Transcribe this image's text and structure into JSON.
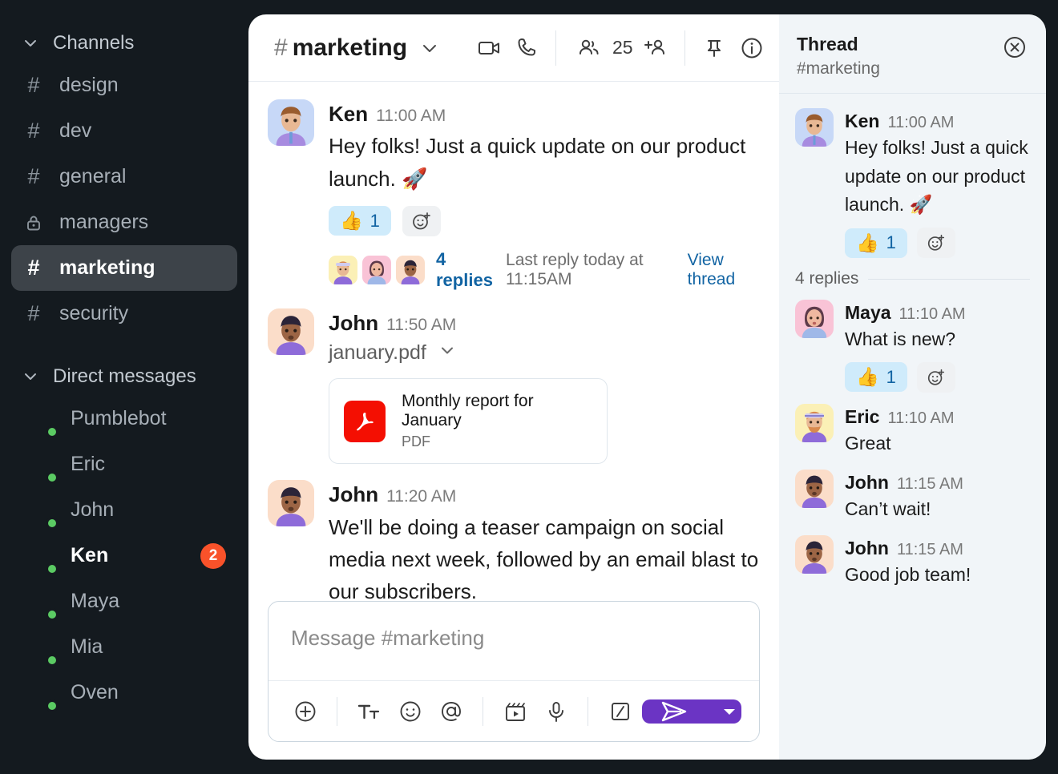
{
  "sidebar": {
    "channels_section": {
      "label": "Channels",
      "icon": "chevron-down-icon"
    },
    "channels": [
      {
        "label": "design",
        "icon": "hash-icon",
        "active": false
      },
      {
        "label": "dev",
        "icon": "hash-icon",
        "active": false
      },
      {
        "label": "general",
        "icon": "hash-icon",
        "active": false
      },
      {
        "label": "managers",
        "icon": "lock-icon",
        "active": false
      },
      {
        "label": "marketing",
        "icon": "hash-icon",
        "active": true
      },
      {
        "label": "security",
        "icon": "hash-icon",
        "active": false
      }
    ],
    "dm_section": {
      "label": "Direct messages",
      "icon": "chevron-down-icon"
    },
    "dms": [
      {
        "label": "Pumblebot",
        "status": "online",
        "badge": "",
        "unread": false,
        "avatar": "bot"
      },
      {
        "label": "Eric",
        "status": "online",
        "badge": "",
        "unread": false,
        "avatar": "eric"
      },
      {
        "label": "John",
        "status": "online",
        "badge": "",
        "unread": false,
        "avatar": "john"
      },
      {
        "label": "Ken",
        "status": "online",
        "badge": "2",
        "unread": true,
        "avatar": "ken"
      },
      {
        "label": "Maya",
        "status": "online",
        "badge": "",
        "unread": false,
        "avatar": "maya"
      },
      {
        "label": "Mia",
        "status": "online",
        "badge": "",
        "unread": false,
        "avatar": "mia"
      },
      {
        "label": "Oven",
        "status": "online",
        "badge": "",
        "unread": false,
        "avatar": "oven"
      }
    ]
  },
  "chat_header": {
    "hash": "#",
    "channel": "marketing",
    "chevron": "chevron-down-icon",
    "video_icon": "video-camera-icon",
    "call_icon": "phone-icon",
    "members_icon": "people-icon",
    "members_count": "25",
    "add_member_icon": "add-person-icon",
    "pin_icon": "pin-icon",
    "info_icon": "info-icon"
  },
  "messages": [
    {
      "author": "Ken",
      "time": "11:00 AM",
      "text": "Hey folks! Just a quick update on our product launch. 🚀",
      "avatar": "ken",
      "reaction": {
        "emoji": "👍",
        "count": "1"
      },
      "add_reaction_icon": "add-reaction-icon",
      "thread": {
        "replies_label": "4 replies",
        "last_reply": "Last reply today at 11:15AM",
        "view_thread": "View thread",
        "participants": [
          "eric",
          "maya",
          "john"
        ]
      }
    },
    {
      "author": "John",
      "time": "11:50 AM",
      "filename": "january.pdf",
      "file_chevron": "chevron-down-icon",
      "avatar": "john",
      "attachment": {
        "title": "Monthly report for January",
        "type": "PDF",
        "icon": "pdf-icon"
      }
    },
    {
      "author": "John",
      "time": "11:20 AM",
      "text": "We'll be doing a teaser campaign on social media next week, followed by an email blast to our subscribers.",
      "avatar": "john"
    }
  ],
  "composer": {
    "placeholder": "Message #marketing",
    "tools": [
      {
        "name": "plus-icon"
      },
      {
        "name": "text-format-icon"
      },
      {
        "name": "emoji-icon"
      },
      {
        "name": "mention-icon"
      },
      {
        "name": "video-clip-icon"
      },
      {
        "name": "microphone-icon"
      },
      {
        "name": "slash-command-icon"
      }
    ],
    "send_icon": "send-icon",
    "send_dropdown_icon": "caret-down-icon",
    "send_color": "#6B34C4"
  },
  "thread_panel": {
    "title": "Thread",
    "subtitle": "#marketing",
    "close_icon": "close-circle-icon",
    "root": {
      "author": "Ken",
      "time": "11:00 AM",
      "text": "Hey folks! Just a quick update on our product launch. 🚀",
      "avatar": "ken",
      "reaction": {
        "emoji": "👍",
        "count": "1"
      },
      "add_reaction_icon": "add-reaction-icon"
    },
    "divider_label": "4 replies",
    "replies": [
      {
        "author": "Maya",
        "time": "11:10 AM",
        "text": "What is new?",
        "avatar": "maya",
        "reaction": {
          "emoji": "👍",
          "count": "1"
        },
        "add_reaction_icon": "add-reaction-icon"
      },
      {
        "author": "Eric",
        "time": "11:10 AM",
        "text": "Great",
        "avatar": "eric"
      },
      {
        "author": "John",
        "time": "11:15 AM",
        "text": "Can’t wait!",
        "avatar": "john"
      },
      {
        "author": "John",
        "time": "11:15 AM",
        "text": "Good job team!",
        "avatar": "john"
      }
    ]
  },
  "colors": {
    "sidebar_bg": "#141A1F",
    "active_channel_bg": "#3D4349",
    "badge": "#F9522A",
    "online": "#5BCB63",
    "accent_link": "#1264A3",
    "send_button": "#6B34C4",
    "reaction_pill": "#CFEBFB",
    "thread_bg": "#F1F5F8"
  }
}
